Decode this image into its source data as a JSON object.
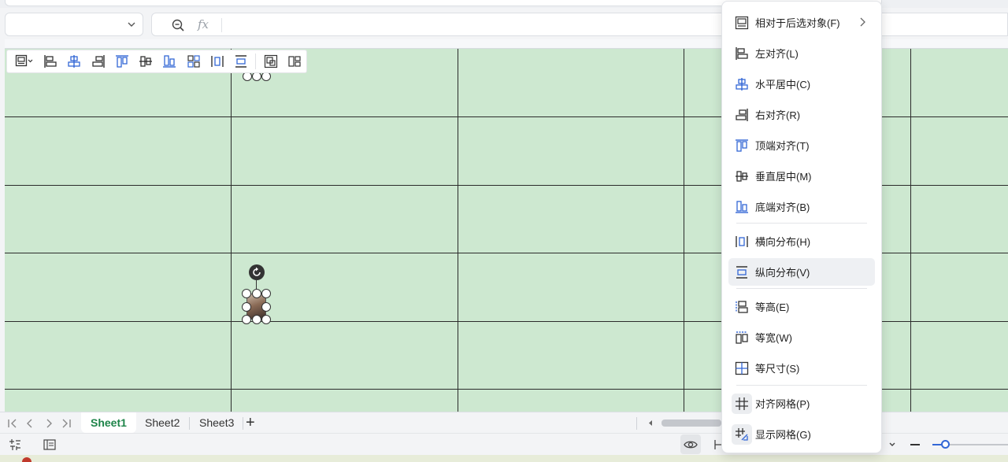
{
  "formula_bar": {
    "name_box_value": "",
    "fx_label": "fx",
    "formula_value": ""
  },
  "sheet": {
    "background": "#cde8d0"
  },
  "align_toolbar": {
    "buttons": [
      "object-align-dropdown",
      "align-left",
      "align-center-horizontal",
      "align-right",
      "align-top",
      "align-middle-vertical",
      "align-bottom",
      "align-to-grid",
      "distribute-horizontal",
      "distribute-vertical",
      "group",
      "ungroup"
    ]
  },
  "context_menu": {
    "items": [
      {
        "label": "相对于后选对象(F)",
        "icon": "relative-object-icon",
        "submenu": true
      },
      {
        "label": "左对齐(L)",
        "icon": "align-left-icon"
      },
      {
        "label": "水平居中(C)",
        "icon": "align-center-horizontal-icon"
      },
      {
        "label": "右对齐(R)",
        "icon": "align-right-icon"
      },
      {
        "label": "顶端对齐(T)",
        "icon": "align-top-icon"
      },
      {
        "label": "垂直居中(M)",
        "icon": "align-middle-vertical-icon"
      },
      {
        "label": "底端对齐(B)",
        "icon": "align-bottom-icon"
      },
      {
        "label": "横向分布(H)",
        "icon": "distribute-horizontal-icon"
      },
      {
        "label": "纵向分布(V)",
        "icon": "distribute-vertical-icon",
        "highlighted": true
      },
      {
        "label": "等高(E)",
        "icon": "equal-height-icon"
      },
      {
        "label": "等宽(W)",
        "icon": "equal-width-icon"
      },
      {
        "label": "等尺寸(S)",
        "icon": "equal-size-icon"
      },
      {
        "label": "对齐网格(P)",
        "icon": "snap-to-grid-icon"
      },
      {
        "label": "显示网格(G)",
        "icon": "show-grid-icon"
      }
    ]
  },
  "sheet_tabs": {
    "tabs": [
      "Sheet1",
      "Sheet2",
      "Sheet3"
    ],
    "active": "Sheet1",
    "add_label": "+"
  }
}
